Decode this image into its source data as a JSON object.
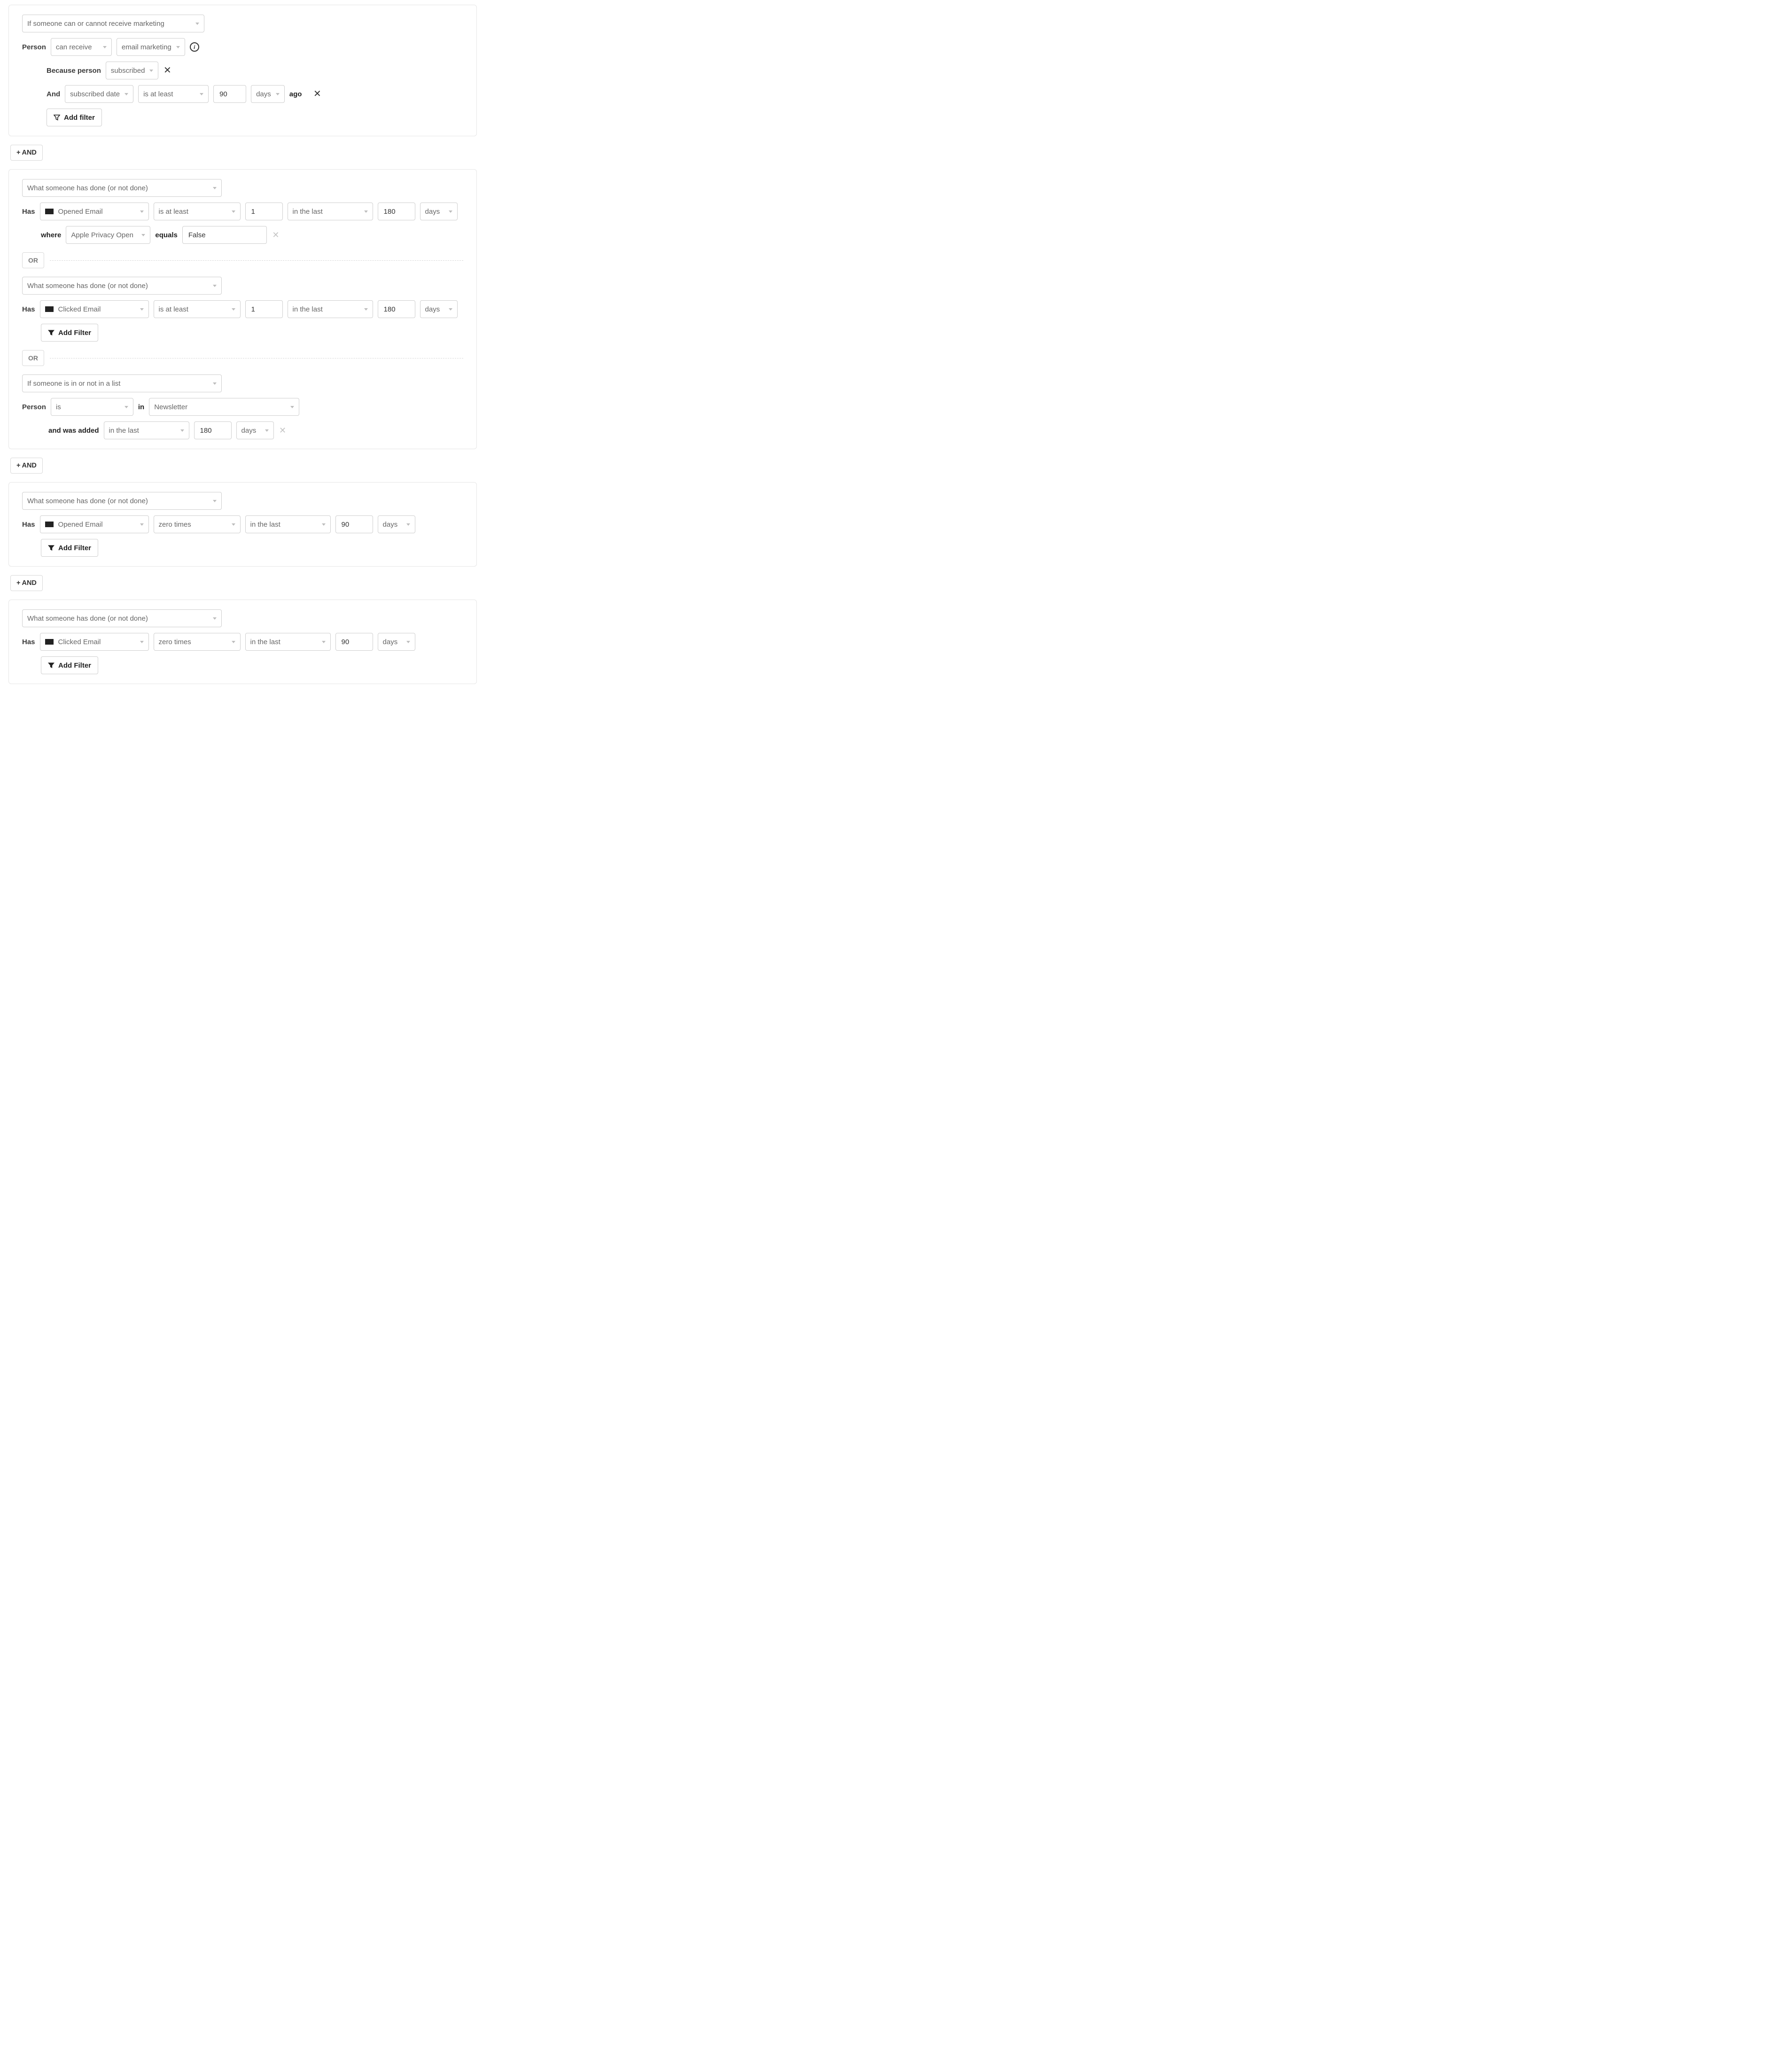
{
  "labels": {
    "person": "Person",
    "because_person": "Because person",
    "and": "And",
    "ago": "ago",
    "has": "Has",
    "where": "where",
    "equals": "equals",
    "in": "in",
    "and_was_added": "and was added",
    "add_filter_outline": "Add filter",
    "add_filter_solid": "Add Filter",
    "or": "OR",
    "and_pill": "AND"
  },
  "block1": {
    "type_select": "If someone can or cannot receive marketing",
    "can_receive": "can receive",
    "channel": "email marketing",
    "because": "subscribed",
    "subscribed_date": "subscribed date",
    "op": "is at least",
    "value": "90",
    "unit": "days"
  },
  "block2": {
    "g1": {
      "type_select": "What someone has done (or not done)",
      "event": "Opened Email",
      "op": "is at least",
      "count": "1",
      "range": "in the last",
      "value": "180",
      "unit": "days",
      "where_field": "Apple Privacy Open",
      "where_value": "False"
    },
    "g2": {
      "type_select": "What someone has done (or not done)",
      "event": "Clicked Email",
      "op": "is at least",
      "count": "1",
      "range": "in the last",
      "value": "180",
      "unit": "days"
    },
    "g3": {
      "type_select": "If someone is in or not in a list",
      "is": "is",
      "list": "Newsletter",
      "added_range": "in the last",
      "added_value": "180",
      "added_unit": "days"
    }
  },
  "block3": {
    "type_select": "What someone has done (or not done)",
    "event": "Opened Email",
    "op": "zero times",
    "range": "in the last",
    "value": "90",
    "unit": "days"
  },
  "block4": {
    "type_select": "What someone has done (or not done)",
    "event": "Clicked Email",
    "op": "zero times",
    "range": "in the last",
    "value": "90",
    "unit": "days"
  }
}
